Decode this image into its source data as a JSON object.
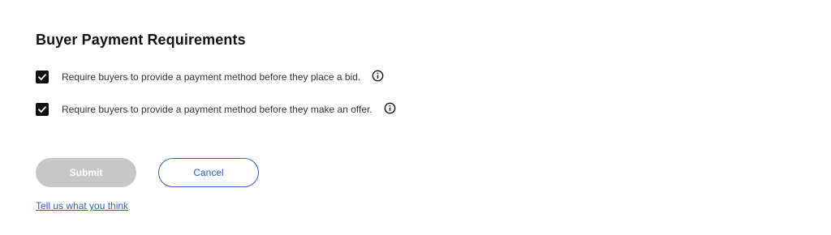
{
  "section": {
    "title": "Buyer Payment Requirements"
  },
  "options": [
    {
      "label": "Require buyers to provide a payment method before they place a bid.",
      "checked": true,
      "icon": "info-icon"
    },
    {
      "label": "Require buyers to provide a payment method before they make an offer.",
      "checked": true,
      "icon": "info-icon"
    }
  ],
  "actions": {
    "submit_label": "Submit",
    "submit_state": "disabled",
    "cancel_label": "Cancel"
  },
  "feedback": {
    "link_label": "Tell us what you think"
  },
  "colors": {
    "text": "#191919",
    "checkbox": "#111111",
    "submit_disabled_bg": "#c7c7c7",
    "link": "#2f5fbf"
  }
}
